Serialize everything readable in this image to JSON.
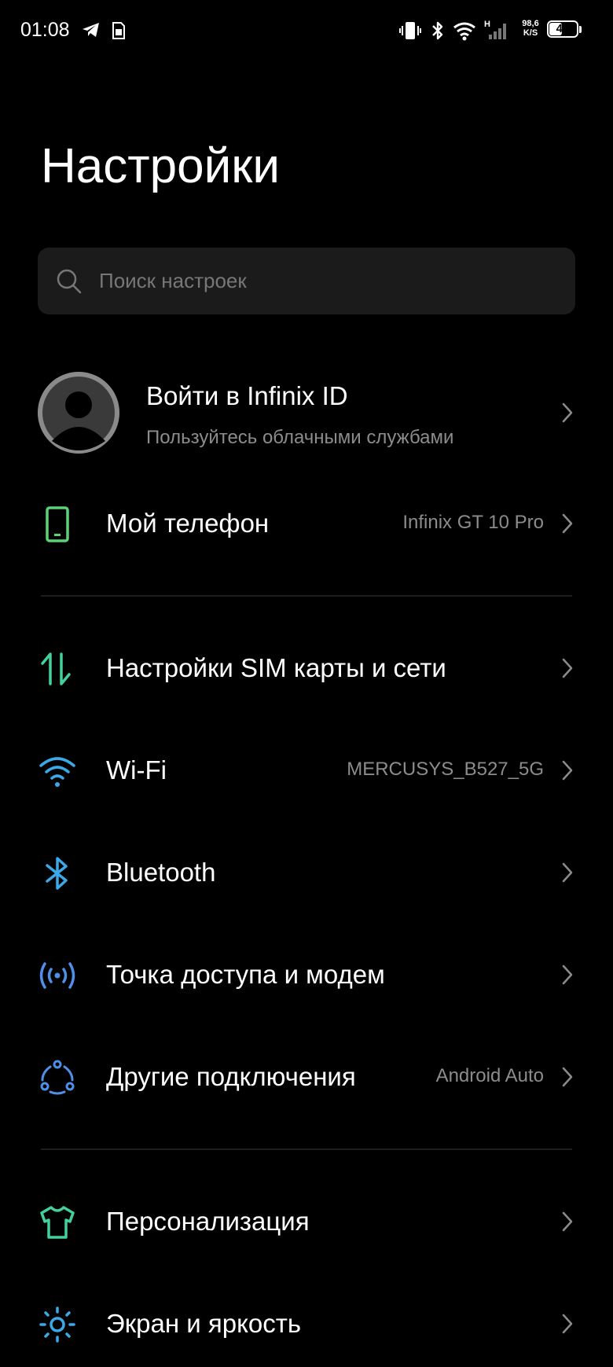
{
  "status_bar": {
    "time": "01:08",
    "net_speed_value": "98,6",
    "net_speed_unit": "K/S",
    "network_type": "H",
    "battery_level": "46",
    "battery_fraction": 0.46
  },
  "page": {
    "title": "Настройки"
  },
  "search": {
    "placeholder": "Поиск настроек"
  },
  "account": {
    "title": "Войти в Infinix ID",
    "subtitle": "Пользуйтесь облачными службами"
  },
  "rows": [
    {
      "label": "Мой телефон",
      "value": "Infinix GT 10 Pro",
      "icon": "phone-icon",
      "color": "#5fd07a"
    },
    {
      "label": "Настройки SIM карты и сети",
      "value": "",
      "icon": "sim-network-icon",
      "color": "#43d19b"
    },
    {
      "label": "Wi-Fi",
      "value": "MERCUSYS_B527_5G",
      "icon": "wifi-icon",
      "color": "#3aa9e8"
    },
    {
      "label": "Bluetooth",
      "value": "",
      "icon": "bluetooth-icon",
      "color": "#3aa9e8"
    },
    {
      "label": "Точка доступа и модем",
      "value": "",
      "icon": "hotspot-icon",
      "color": "#4f8fe8"
    },
    {
      "label": "Другие подключения",
      "value": "Android Auto",
      "icon": "connections-icon",
      "color": "#4f8fe8"
    },
    {
      "label": "Персонализация",
      "value": "",
      "icon": "tshirt-icon",
      "color": "#43d19b"
    },
    {
      "label": "Экран и яркость",
      "value": "",
      "icon": "brightness-icon",
      "color": "#3aa9e8"
    }
  ],
  "colors": {
    "background": "#000000",
    "search_bg": "#1b1b1b",
    "secondary_text": "#8c8c8c",
    "chevron": "#8a8a8a"
  }
}
